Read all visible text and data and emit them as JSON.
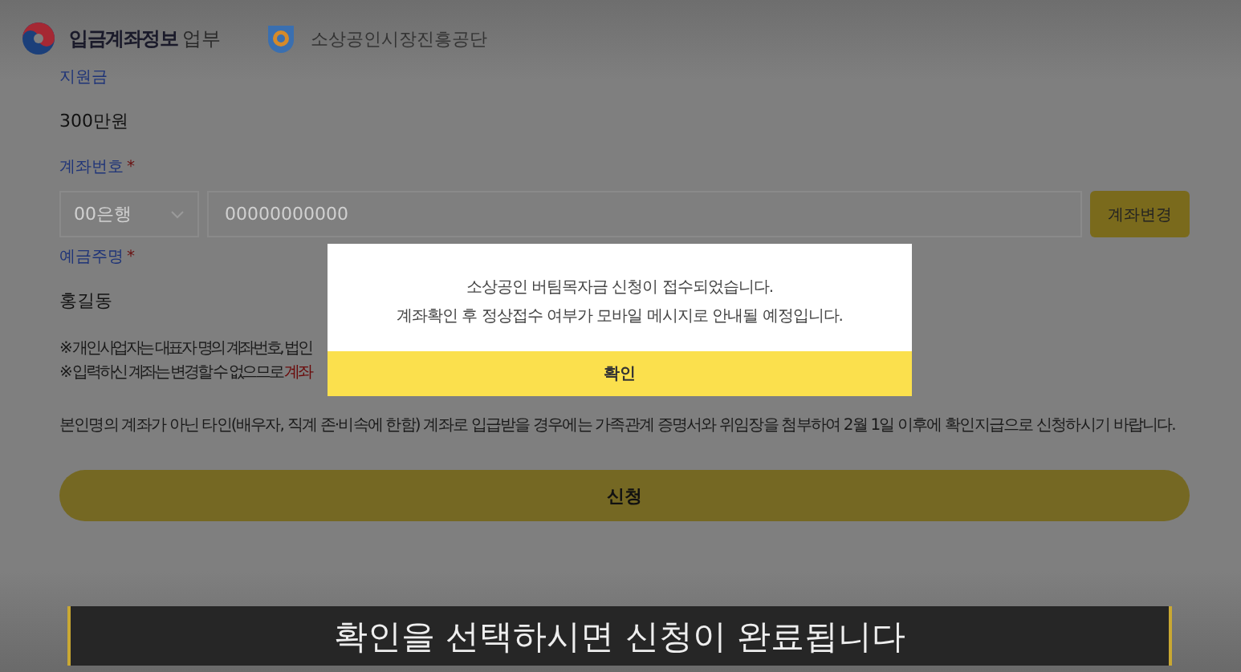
{
  "header": {
    "title": "입금계좌정보",
    "ministry_fragment": "업부",
    "agency": "소상공인시장진흥공단"
  },
  "fields": [
    {
      "kind": "static",
      "label": "지원금",
      "value": "300만원"
    },
    {
      "kind": "account",
      "label": "계좌번호",
      "required_mark": "*",
      "bank_placeholder": "00은행",
      "account_placeholder": "00000000000",
      "button": "계좌변경"
    },
    {
      "kind": "static",
      "label": "예금주명",
      "required_mark": "*",
      "value": "홍길동"
    }
  ],
  "notes": [
    {
      "text": "※ 개인사업자는 대표자 명의 계좌번호, 법인"
    },
    {
      "text": "※ 입력하신 계좌는 변경할 수 없으므로 ",
      "highlight": "계좌"
    }
  ],
  "notice": "본인명의 계좌가 아닌 타인(배우자, 직계 존·비속에 한함) 계좌로 입급받을 경우에는 가족관계 증명서와 위임장을 첨부하여 2월 1일 이후에 확인지급으로 신청하시기 바랍니다.",
  "submit": "신청",
  "modal": {
    "lines": [
      "소상공인 버팀목자금 신청이 접수되었습니다.",
      "계좌확인 후 정상접수 여부가 모바일 메시지로 안내될 예정입니다."
    ],
    "button": "확인"
  },
  "caption": "확인을 선택하시면 신청이 완료됩니다"
}
